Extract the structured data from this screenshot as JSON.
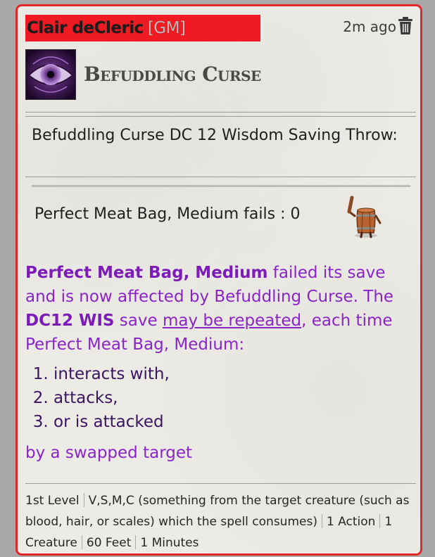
{
  "chat_message": {
    "speaker": "Clair deCleric",
    "speaker_tag": "[GM]",
    "timestamp": "2m ago",
    "delete_icon": "trash-icon",
    "colors": {
      "gm_bar": "#f01b22",
      "card_border": "#e4262b",
      "effect_text": "#8a24c6"
    }
  },
  "spell": {
    "icon": "eye-curse-icon",
    "title": "Befuddling Curse"
  },
  "saving_throw": {
    "text": "Befuddling Curse DC 12 Wisdom Saving Throw:"
  },
  "result": {
    "text": "Perfect Meat Bag, Medium fails : 0",
    "token_icon": "barrel-creature-token"
  },
  "effect": {
    "target": "Perfect Meat Bag, Medium",
    "p1": " failed its save and is now affected by Befuddling Curse. The ",
    "dc": "DC12 WIS",
    "p2": " save ",
    "link": "may be repeated",
    "p3": ", each time Perfect Meat Bag, Medium:",
    "list": [
      "interacts with,",
      "attacks,",
      "or is attacked"
    ],
    "tail": "by a swapped target"
  },
  "footer": {
    "level": "1st Level",
    "components": "V,S,M,C (something from the target creature (such as blood, hair, or scales) which the spell consumes)",
    "casting_time": "1 Action",
    "targets": "1 Creature",
    "range": "60 Feet",
    "duration": "1 Minutes"
  }
}
